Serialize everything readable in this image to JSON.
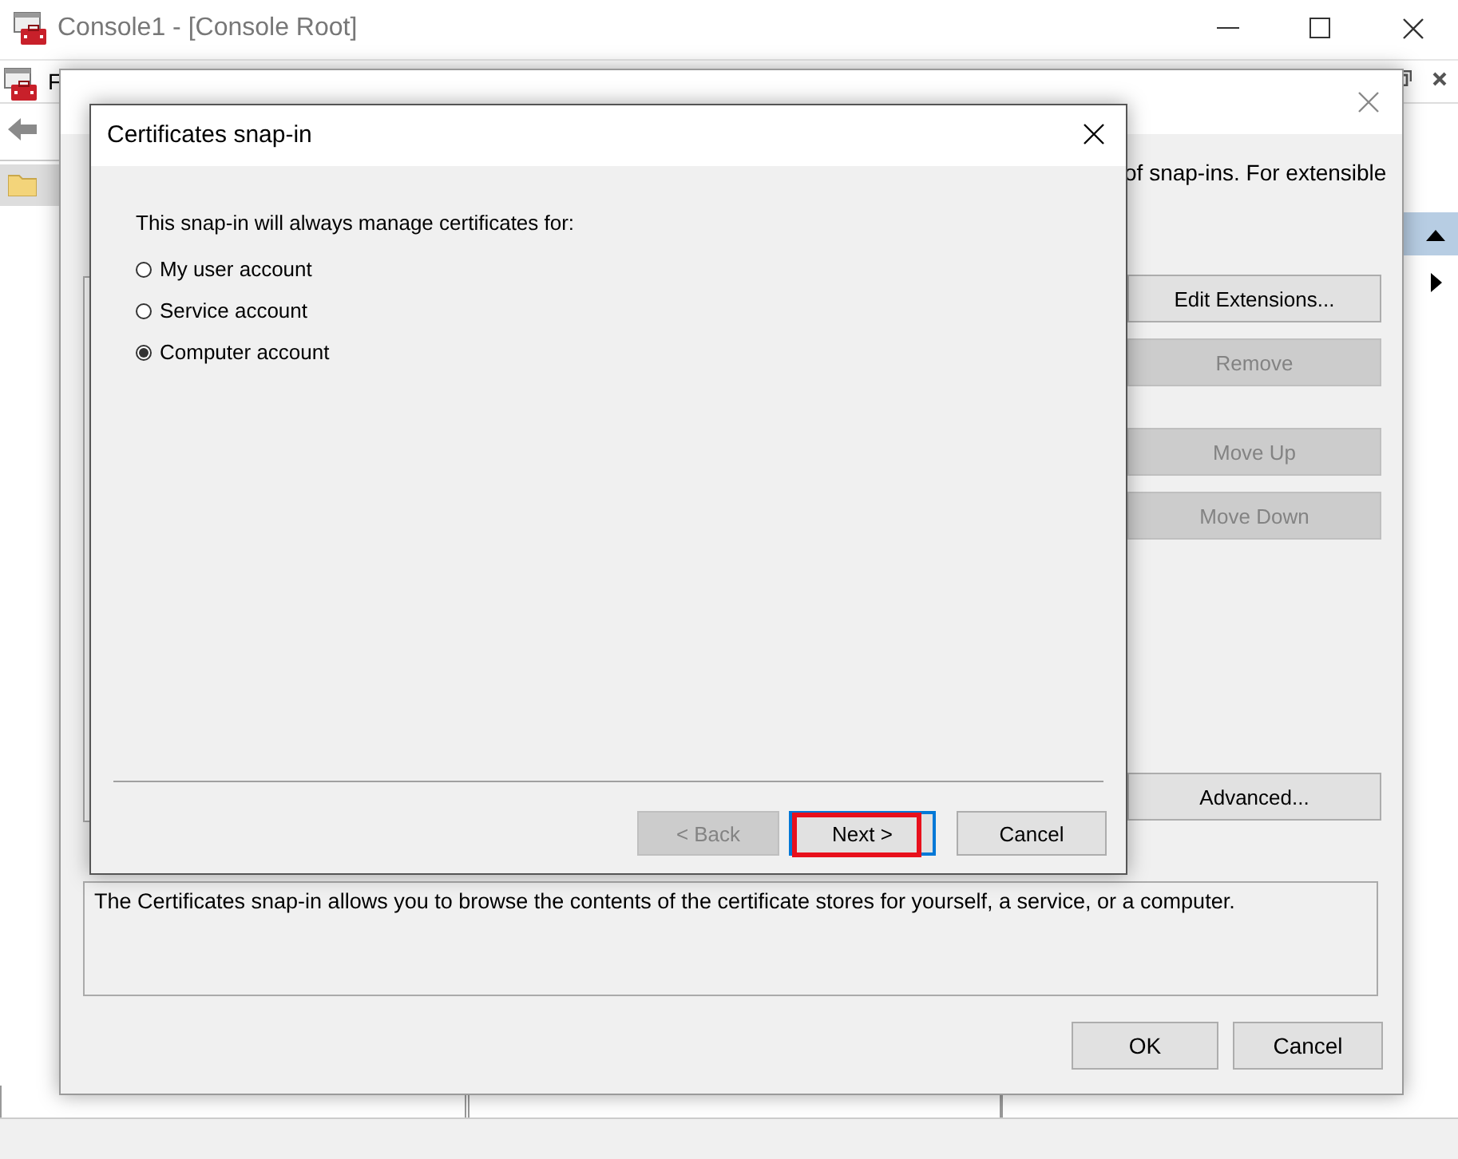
{
  "main_window": {
    "title": "Console1 - [Console Root]",
    "menu_fragment": "F"
  },
  "snapins_dialog": {
    "intro_tail": "of snap-ins. For extensible",
    "side_buttons": [
      {
        "label": "Edit Extensions...",
        "disabled": false
      },
      {
        "label": "Remove",
        "disabled": true
      },
      {
        "label": "Move Up",
        "disabled": true
      },
      {
        "label": "Move Down",
        "disabled": true
      },
      {
        "label": "Advanced...",
        "disabled": false
      }
    ],
    "description": "The Certificates snap-in allows you to browse the contents of the certificate stores for yourself, a service, or a computer.",
    "footer_buttons": [
      {
        "label": "OK"
      },
      {
        "label": "Cancel"
      }
    ]
  },
  "cert_dialog": {
    "title": "Certificates snap-in",
    "prompt": "This snap-in will always manage certificates for:",
    "options": [
      {
        "label": "My user account",
        "selected": false
      },
      {
        "label": "Service account",
        "selected": false
      },
      {
        "label": "Computer account",
        "selected": true
      }
    ],
    "buttons": [
      {
        "label": "< Back",
        "disabled": true,
        "focused": false,
        "highlighted": false
      },
      {
        "label": "Next >",
        "disabled": false,
        "focused": true,
        "highlighted": true
      },
      {
        "label": "Cancel",
        "disabled": false,
        "focused": false,
        "highlighted": false
      }
    ]
  }
}
